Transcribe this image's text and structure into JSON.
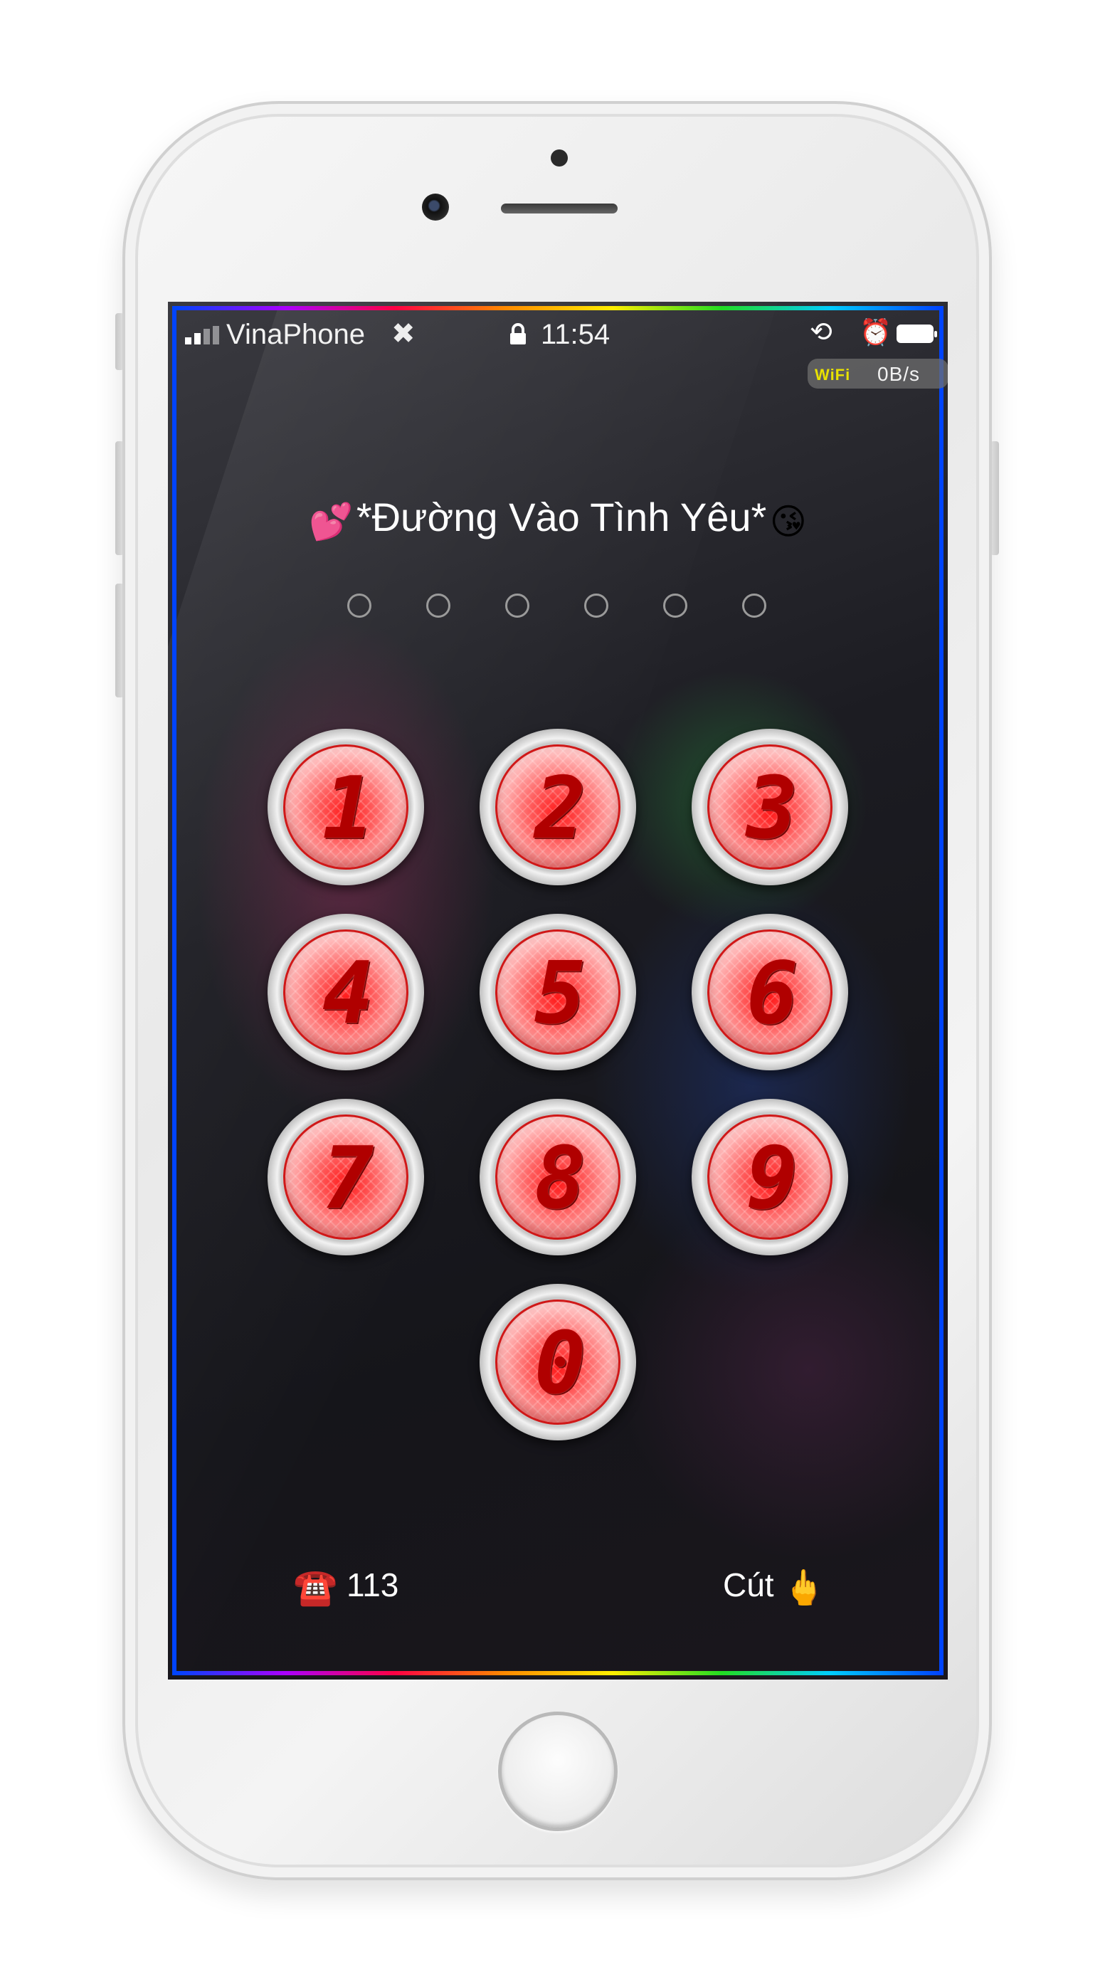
{
  "status_bar": {
    "carrier": "VinaPhone",
    "time": "11:54",
    "network_label": "WiFi",
    "network_speed": "0B/s",
    "battery_level": 1.0,
    "icons": [
      "signal-bars-icon",
      "settings-icon",
      "lock-icon",
      "rotation-lock-icon",
      "alarm-icon",
      "battery-icon"
    ]
  },
  "lock_screen": {
    "title_prefix_emoji": "💕",
    "title": "*Đường Vào Tình Yêu*",
    "title_suffix_emoji": "😘",
    "passcode_length": 6,
    "keys": [
      "1",
      "2",
      "3",
      "4",
      "5",
      "6",
      "7",
      "8",
      "9",
      "0"
    ],
    "emergency": {
      "icon": "☎️",
      "label": "113"
    },
    "cancel": {
      "label": "Cút",
      "icon": "🖕"
    }
  },
  "colors": {
    "key_red": "#ff1a1a",
    "digit_red": "#b00000",
    "wifi_label_yellow": "#e8e200",
    "screen_bg": "#121214"
  }
}
